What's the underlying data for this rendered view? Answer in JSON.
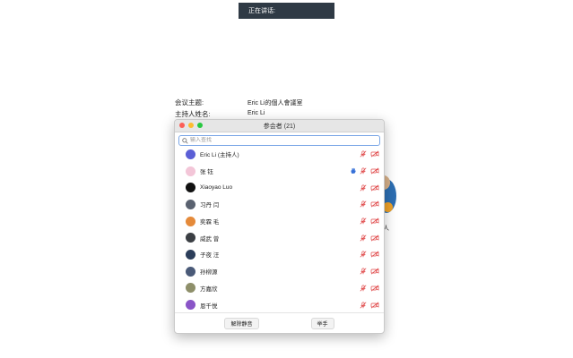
{
  "speaking": {
    "label": "正在讲话:"
  },
  "meeting": {
    "topic_label": "会议主题:",
    "topic_value": "Eric Li的個人會議室",
    "host_label": "主持人姓名:",
    "host_value": "Eric Li"
  },
  "panel": {
    "title": "参会者 (21)",
    "search_placeholder": "输入查找",
    "participants": [
      {
        "name": "Eric Li (主持人)",
        "avatar_color": "#5b5fd6",
        "hand": false
      },
      {
        "name": "张 钰",
        "avatar_color": "#f3c6d8",
        "hand": true
      },
      {
        "name": "Xiaoyao Luo",
        "avatar_color": "#111111",
        "hand": false
      },
      {
        "name": "习丹 闫",
        "avatar_color": "#5a6270",
        "hand": false
      },
      {
        "name": "奕霖 毛",
        "avatar_color": "#e58a3a",
        "hand": false
      },
      {
        "name": "威武 曾",
        "avatar_color": "#3b3f44",
        "hand": false
      },
      {
        "name": "子夜 汪",
        "avatar_color": "#2c3e5a",
        "hand": false
      },
      {
        "name": "孙柳源",
        "avatar_color": "#4a5a78",
        "hand": false
      },
      {
        "name": "方嘉欣",
        "avatar_color": "#8e8f6a",
        "hand": false
      },
      {
        "name": "恩千悦",
        "avatar_color": "#8a55c7",
        "hand": false
      }
    ],
    "unmute_button": "解除静音",
    "raise_hand_button": "举手"
  },
  "background_label": "人",
  "colors": {
    "accent": "#7aa6e6",
    "muted_red": "#e0494a",
    "hand_blue": "#3570d8"
  }
}
